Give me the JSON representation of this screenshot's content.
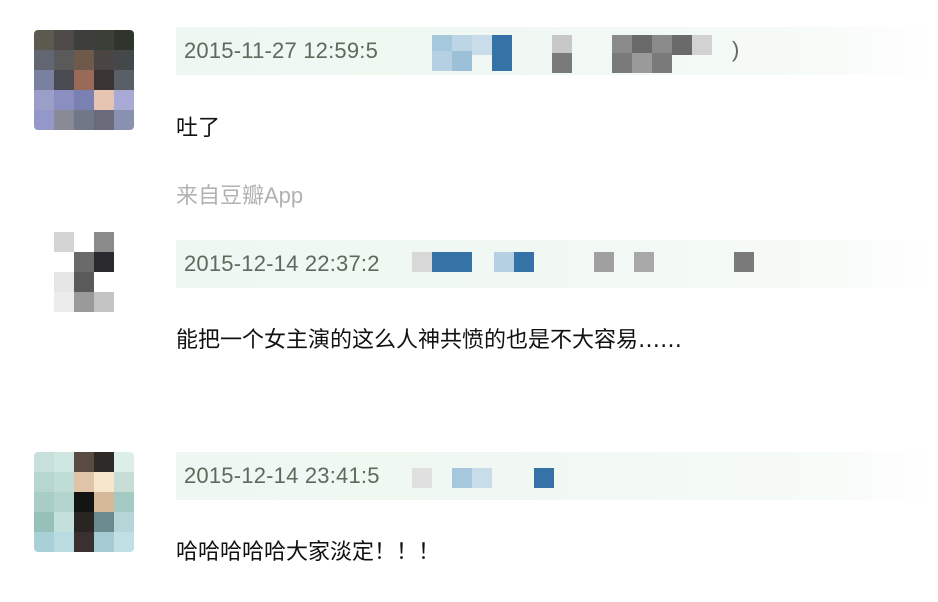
{
  "comments": [
    {
      "timestamp": "2015-11-27 12:59:5",
      "text": "吐了",
      "source": "来自豆瓣App",
      "trailing": ")"
    },
    {
      "timestamp": "2015-12-14 22:37:2",
      "text": "能把一个女主演的这么人神共愤的也是不大容易……"
    },
    {
      "timestamp": "2015-12-14 23:41:5",
      "text": "哈哈哈哈哈大家淡定！！！"
    }
  ],
  "colors": {
    "meta_bg": "#eef7f1",
    "timestamp": "#5c6b5c",
    "source": "#b2b2b2",
    "mosaic_blue": "#3572a5",
    "mosaic_light_blue": "#a6c8dc"
  },
  "icons": [
    "avatar-pixelated",
    "username-pixelated"
  ]
}
